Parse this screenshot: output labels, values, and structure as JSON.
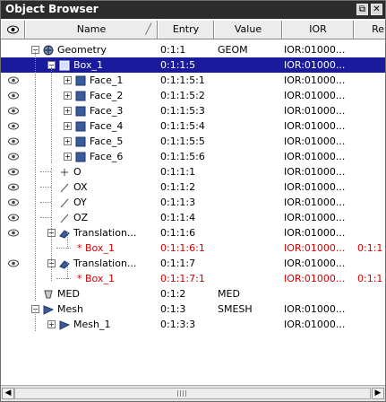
{
  "window": {
    "title": "Object Browser",
    "restore_symbol": "⧉",
    "close_symbol": "✕"
  },
  "columns": [
    {
      "label": "",
      "icon": "eye-icon"
    },
    {
      "label": "Name",
      "sort_indicator": "╱"
    },
    {
      "label": "Entry"
    },
    {
      "label": "Value"
    },
    {
      "label": "IOR"
    },
    {
      "label": "Re"
    }
  ],
  "rows": [
    {
      "name": "Geometry",
      "icon": "geometry-icon",
      "entry": "0:1:1",
      "value": "GEOM",
      "ior": "IOR:01000...",
      "ref": "",
      "eye": false,
      "selected": false,
      "red": false
    },
    {
      "name": "Box_1",
      "icon": "box-icon",
      "entry": "0:1:1:5",
      "value": "",
      "ior": "IOR:01000...",
      "ref": "",
      "eye": false,
      "selected": true,
      "red": false
    },
    {
      "name": "Face_1",
      "icon": "face-icon",
      "entry": "0:1:1:5:1",
      "value": "",
      "ior": "IOR:01000...",
      "ref": "",
      "eye": true,
      "selected": false,
      "red": false
    },
    {
      "name": "Face_2",
      "icon": "face-icon",
      "entry": "0:1:1:5:2",
      "value": "",
      "ior": "IOR:01000...",
      "ref": "",
      "eye": true,
      "selected": false,
      "red": false
    },
    {
      "name": "Face_3",
      "icon": "face-icon",
      "entry": "0:1:1:5:3",
      "value": "",
      "ior": "IOR:01000...",
      "ref": "",
      "eye": true,
      "selected": false,
      "red": false
    },
    {
      "name": "Face_4",
      "icon": "face-icon",
      "entry": "0:1:1:5:4",
      "value": "",
      "ior": "IOR:01000...",
      "ref": "",
      "eye": true,
      "selected": false,
      "red": false
    },
    {
      "name": "Face_5",
      "icon": "face-icon",
      "entry": "0:1:1:5:5",
      "value": "",
      "ior": "IOR:01000...",
      "ref": "",
      "eye": true,
      "selected": false,
      "red": false
    },
    {
      "name": "Face_6",
      "icon": "face-icon",
      "entry": "0:1:1:5:6",
      "value": "",
      "ior": "IOR:01000...",
      "ref": "",
      "eye": true,
      "selected": false,
      "red": false
    },
    {
      "name": "O",
      "icon": "point-icon",
      "entry": "0:1:1:1",
      "value": "",
      "ior": "IOR:01000...",
      "ref": "",
      "eye": true,
      "selected": false,
      "red": false
    },
    {
      "name": "OX",
      "icon": "vector-icon",
      "entry": "0:1:1:2",
      "value": "",
      "ior": "IOR:01000...",
      "ref": "",
      "eye": true,
      "selected": false,
      "red": false
    },
    {
      "name": "OY",
      "icon": "vector-icon",
      "entry": "0:1:1:3",
      "value": "",
      "ior": "IOR:01000...",
      "ref": "",
      "eye": true,
      "selected": false,
      "red": false
    },
    {
      "name": "OZ",
      "icon": "vector-icon",
      "entry": "0:1:1:4",
      "value": "",
      "ior": "IOR:01000...",
      "ref": "",
      "eye": true,
      "selected": false,
      "red": false
    },
    {
      "name": "Translation...",
      "icon": "translation-icon",
      "entry": "0:1:1:6",
      "value": "",
      "ior": "IOR:01000...",
      "ref": "",
      "eye": true,
      "selected": false,
      "red": false
    },
    {
      "name": "* Box_1",
      "icon": "",
      "entry": "0:1:1:6:1",
      "value": "",
      "ior": "IOR:01000...",
      "ref": "0:1:1",
      "eye": false,
      "selected": false,
      "red": true
    },
    {
      "name": "Translation...",
      "icon": "translation-icon",
      "entry": "0:1:1:7",
      "value": "",
      "ior": "IOR:01000...",
      "ref": "",
      "eye": true,
      "selected": false,
      "red": false
    },
    {
      "name": "* Box_1",
      "icon": "",
      "entry": "0:1:1:7:1",
      "value": "",
      "ior": "IOR:01000...",
      "ref": "0:1:1",
      "eye": false,
      "selected": false,
      "red": true
    },
    {
      "name": "MED",
      "icon": "med-icon",
      "entry": "0:1:2",
      "value": "MED",
      "ior": "",
      "ref": "",
      "eye": false,
      "selected": false,
      "red": false
    },
    {
      "name": "Mesh",
      "icon": "mesh-icon",
      "entry": "0:1:3",
      "value": "SMESH",
      "ior": "IOR:01000...",
      "ref": "",
      "eye": false,
      "selected": false,
      "red": false
    },
    {
      "name": "Mesh_1",
      "icon": "mesh-icon",
      "entry": "0:1:3:3",
      "value": "",
      "ior": "IOR:01000...",
      "ref": "",
      "eye": false,
      "selected": false,
      "red": false
    }
  ],
  "scrollbar": {
    "left_arrow": "◀",
    "right_arrow": "▶"
  },
  "colors": {
    "selection": "#1a1a9c",
    "reference_text": "#d40000",
    "titlebar": "#2c2c2c"
  }
}
